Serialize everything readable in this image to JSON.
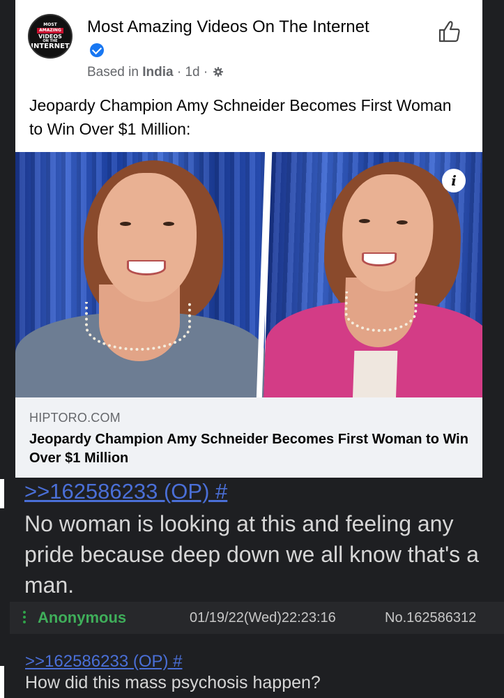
{
  "facebook_post": {
    "page_logo_text": [
      "MOST",
      "AMAZING",
      "VIDEOS",
      "ON THE",
      "INTERNET"
    ],
    "page_name": "Most Amazing Videos On The Internet",
    "meta_prefix": "Based in",
    "meta_location": "India",
    "meta_time": "· 1d ·",
    "post_text": "Jeopardy Champion Amy Schneider Becomes First Woman to Win Over $1 Million:",
    "info_glyph": "i",
    "link_domain": "HIPTORO.COM",
    "link_title": "Jeopardy Champion Amy Schneider Becomes First Woman to Win Over $1 Million",
    "colors": {
      "verified": "#1877f2",
      "link_box_bg": "#f0f2f5"
    }
  },
  "thread": {
    "post1": {
      "quote": ">>162586233 (OP) #",
      "text": "No woman is looking at this and feeling any pride because deep down we all know that's a man."
    },
    "post2": {
      "name": "Anonymous",
      "date": "01/19/22(Wed)22:23:16",
      "number": "No.162586312",
      "quote": ">>162586233 (OP) #",
      "text": "How did this mass psychosis happen?"
    },
    "colors": {
      "name": "#3fae5a",
      "quote_link": "#4a6fd7",
      "bg": "#1e1f22"
    }
  }
}
